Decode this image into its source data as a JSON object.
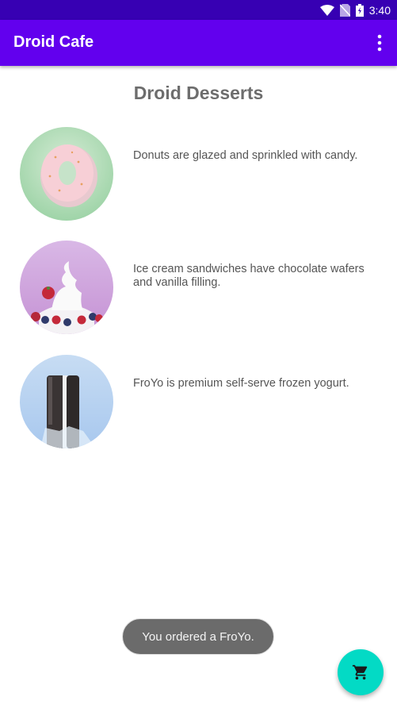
{
  "status_bar": {
    "time": "3:40",
    "icons": [
      "wifi-icon",
      "no-sim-icon",
      "battery-icon"
    ],
    "color": "#3700b3"
  },
  "app_bar": {
    "title": "Droid Cafe",
    "menu_icon": "overflow-menu-icon",
    "color": "#6200ee"
  },
  "main": {
    "title": "Droid Desserts",
    "desserts": [
      {
        "name": "donut",
        "description": "Donuts are glazed and sprinkled with candy."
      },
      {
        "name": "ice-cream-sandwich",
        "description": "Ice cream sandwiches have chocolate wafers and vanilla filling."
      },
      {
        "name": "froyo",
        "description": "FroYo is premium self-serve frozen yogurt."
      }
    ]
  },
  "toast": {
    "message": "You ordered a FroYo."
  },
  "fab": {
    "icon": "shopping-cart-icon",
    "color": "#03dac5"
  }
}
